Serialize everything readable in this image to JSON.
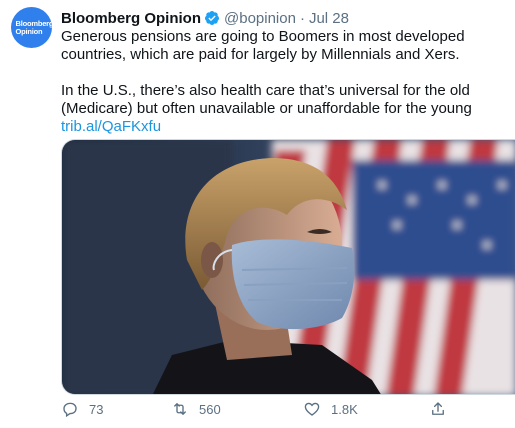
{
  "account": {
    "avatar_text_1": "Bloomberg",
    "avatar_text_2": "Opinion",
    "name": "Bloomberg Opinion",
    "handle": "@bopinion",
    "separator": "·",
    "date": "Jul 28"
  },
  "tweet": {
    "paragraph_1": "Generous pensions are going to Boomers in most developed countries, which are paid for largely by Millennials and Xers.",
    "paragraph_2": "In the U.S., there’s also health care that’s universal for the old (Medicare) but often unavailable or unaffordable for the young",
    "link": "trib.al/QaFKxfu"
  },
  "media": {
    "description_icon": "photo-woman-face-mask-american-flag"
  },
  "actions": {
    "reply_count": "73",
    "retweet_count": "560",
    "like_count": "1.8K"
  },
  "colors": {
    "link": "#1b95e0",
    "muted": "#5b7083",
    "avatar": "#2f80ed",
    "verified": "#1da1f2"
  }
}
